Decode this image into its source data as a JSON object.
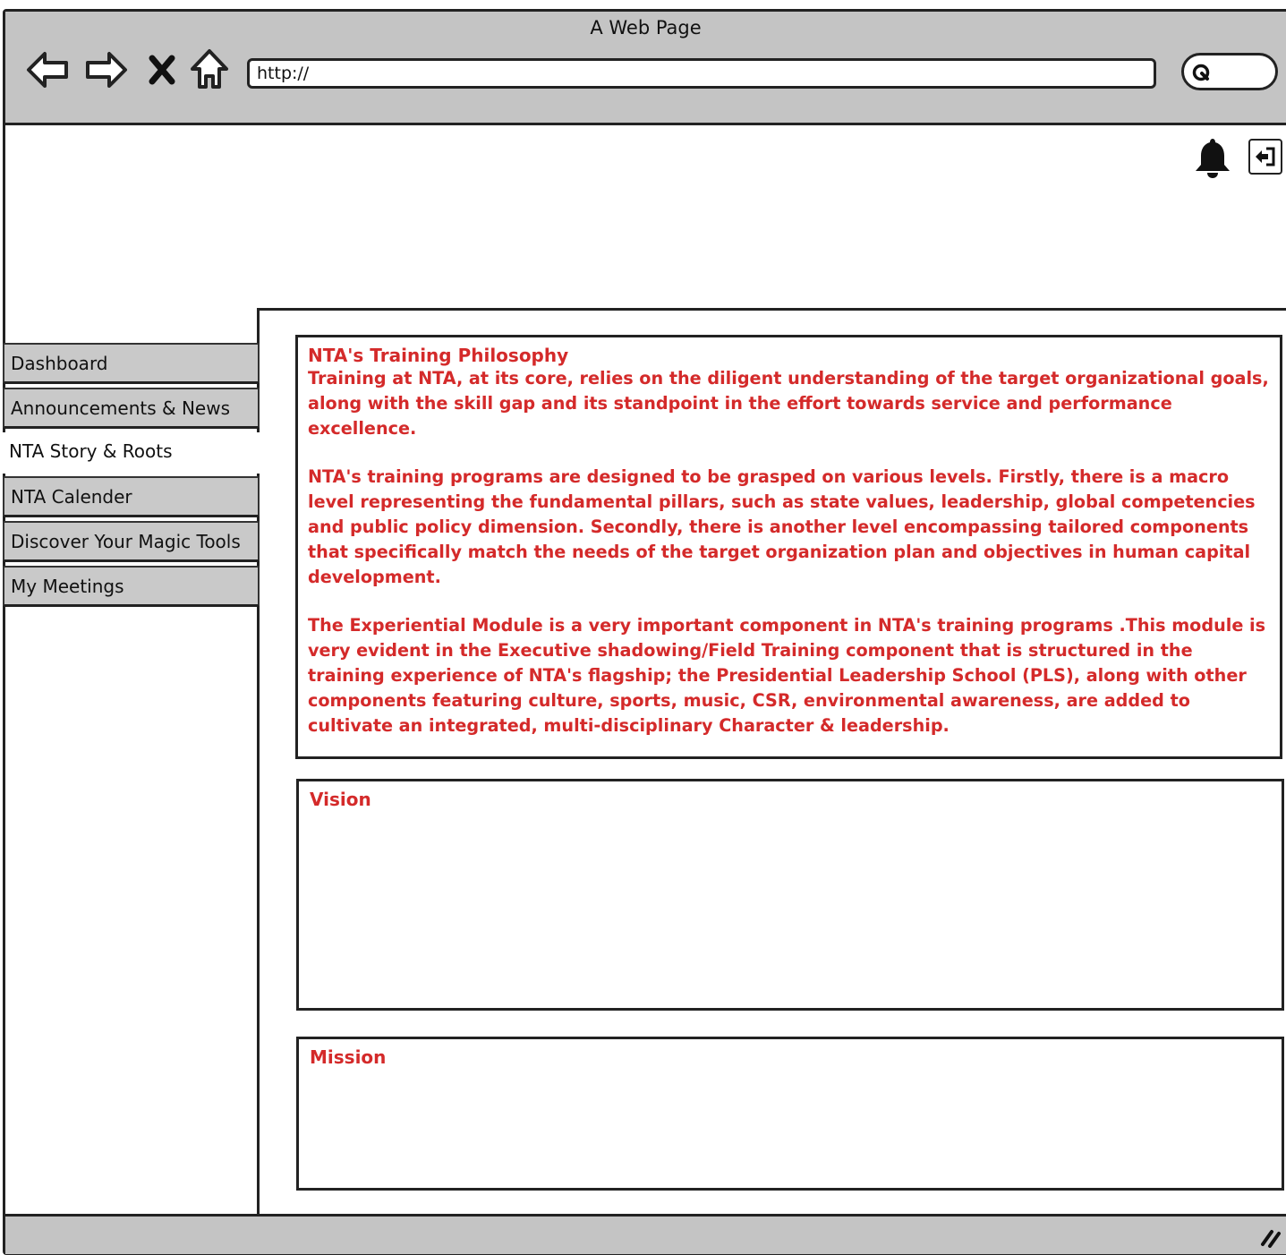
{
  "window": {
    "title": "A Web Page"
  },
  "browser": {
    "url_value": "http://",
    "icons": {
      "back": "back-arrow-icon",
      "forward": "forward-arrow-icon",
      "stop": "close-x-icon",
      "home": "home-icon",
      "search": "search-icon"
    }
  },
  "header": {
    "icons": {
      "notifications": "bell-icon",
      "logout": "logout-icon"
    }
  },
  "sidebar": {
    "items": [
      {
        "label": "Dashboard",
        "active": false
      },
      {
        "label": "Announcements & News",
        "active": false
      },
      {
        "label": "NTA Story & Roots",
        "active": true
      },
      {
        "label": "NTA Calender",
        "active": false
      },
      {
        "label": "Discover Your Magic Tools",
        "active": false
      },
      {
        "label": "My Meetings",
        "active": false
      }
    ]
  },
  "sections": {
    "philosophy": {
      "title": "NTA's Training Philosophy",
      "paragraphs": [
        "Training at NTA, at its core, relies on the diligent understanding of the target organizational goals, along with the skill gap and its standpoint in the effort towards service and performance excellence.",
        "NTA's training programs are designed to be grasped on various levels. Firstly, there is a macro level representing the fundamental pillars, such as state values, leadership, global competencies and public policy dimension. Secondly, there is another level encompassing tailored components that specifically match the needs of the target organization plan and objectives in human capital development.",
        "The Experiential Module is a very important component in NTA's training programs .This module is very evident in the Executive shadowing/Field Training component that is structured in the training experience of NTA's flagship; the Presidential Leadership School (PLS), along with other components featuring culture, sports, music, CSR, environmental awareness, are added to cultivate an integrated, multi-disciplinary Character & leadership."
      ]
    },
    "vision": {
      "title": "Vision"
    },
    "mission": {
      "title": "Mission"
    }
  },
  "colors": {
    "accent_text": "#d42a2a",
    "chrome": "#c4c4c4",
    "tab": "#c9c9c9"
  }
}
